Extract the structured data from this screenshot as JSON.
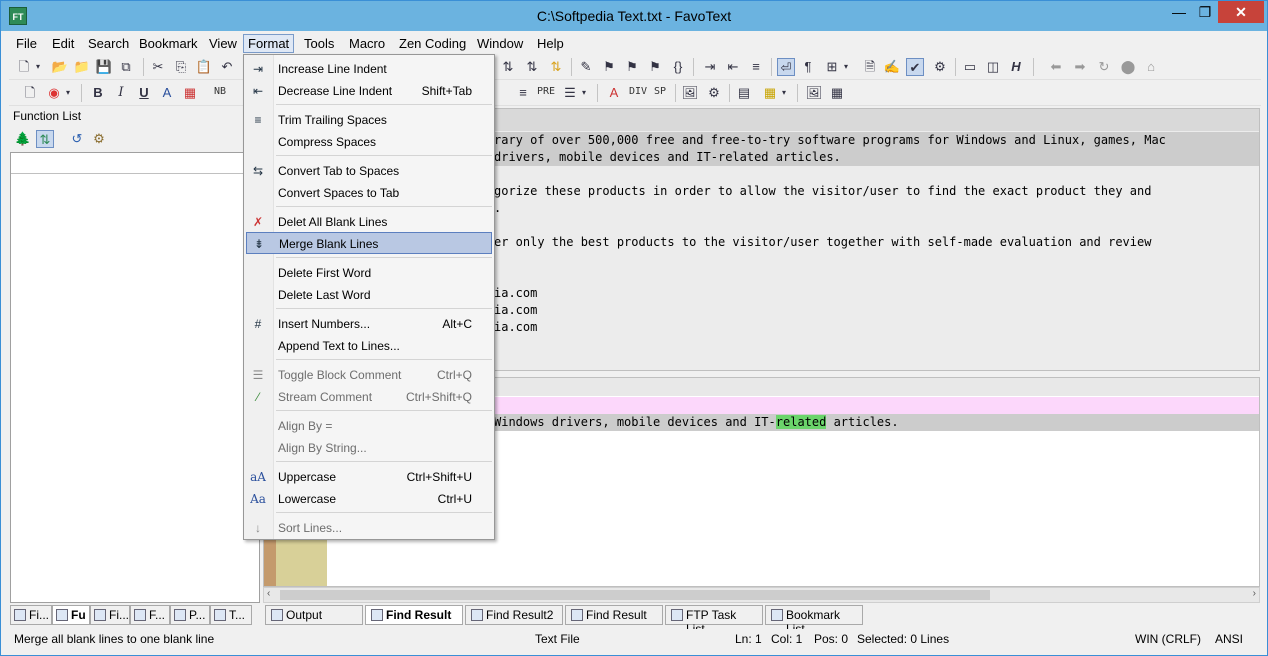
{
  "window": {
    "title": "C:\\Softpedia Text.txt - FavoText",
    "app_icon_text": "FT",
    "minimize": "—",
    "maximize": "❐",
    "close": "✕"
  },
  "menu": [
    "File",
    "Edit",
    "Search",
    "Bookmark",
    "View",
    "Format",
    "Tools",
    "Macro",
    "Zen Coding",
    "Window",
    "Help"
  ],
  "toolbar2_text": {
    "nb": "NB",
    "pre": "PRE",
    "div": "DIV",
    "sp": "SP"
  },
  "function_list": {
    "title": "Function List"
  },
  "editor": {
    "lines": [
      "rary of over 500,000 free and free-to-try software programs for Windows and Linux, games, Mac",
      "drivers, mobile devices and IT-related articles.",
      "",
      "gorize these products in order to allow the visitor/user to find the exact product they and",
      ".",
      "",
      "er only the best products to the visitor/user together with self-made evaluation and review",
      "",
      "",
      "ia.com",
      "ia.com",
      "ia.com"
    ]
  },
  "result_pane": {
    "line_before": "Windows drivers, mobile devices and IT-",
    "match": "related",
    "line_after": " articles."
  },
  "format_menu": {
    "items": [
      {
        "label": "Increase Line Indent",
        "shortcut": "",
        "icon": "increase-indent-icon",
        "glyph": "⇥",
        "disabled": false,
        "selected": false
      },
      {
        "label": "Decrease Line Indent",
        "shortcut": "Shift+Tab",
        "icon": "decrease-indent-icon",
        "glyph": "⇤",
        "disabled": false,
        "selected": false
      },
      {
        "label": "Trim Trailing Spaces",
        "shortcut": "",
        "icon": "trim-spaces-icon",
        "glyph": "≡",
        "disabled": false,
        "selected": false
      },
      {
        "label": "Compress Spaces",
        "shortcut": "",
        "icon": "",
        "glyph": "",
        "disabled": false,
        "selected": false
      },
      {
        "label": "Convert Tab to Spaces",
        "shortcut": "",
        "icon": "tab-to-spaces-icon",
        "glyph": "⇆",
        "disabled": false,
        "selected": false
      },
      {
        "label": "Convert Spaces to Tab",
        "shortcut": "",
        "icon": "",
        "glyph": "",
        "disabled": false,
        "selected": false
      },
      {
        "label": "Delet All Blank Lines",
        "shortcut": "",
        "icon": "delete-blank-lines-icon",
        "glyph": "✗",
        "disabled": false,
        "selected": false
      },
      {
        "label": "Merge Blank Lines",
        "shortcut": "",
        "icon": "merge-blank-lines-icon",
        "glyph": "⇟",
        "disabled": false,
        "selected": true
      },
      {
        "label": "Delete First Word",
        "shortcut": "",
        "icon": "",
        "glyph": "",
        "disabled": false,
        "selected": false
      },
      {
        "label": "Delete Last Word",
        "shortcut": "",
        "icon": "",
        "glyph": "",
        "disabled": false,
        "selected": false
      },
      {
        "label": "Insert Numbers...",
        "shortcut": "Alt+C",
        "icon": "insert-numbers-icon",
        "glyph": "#",
        "disabled": false,
        "selected": false
      },
      {
        "label": "Append Text to Lines...",
        "shortcut": "",
        "icon": "",
        "glyph": "",
        "disabled": false,
        "selected": false
      },
      {
        "label": "Toggle Block Comment",
        "shortcut": "Ctrl+Q",
        "icon": "block-comment-icon",
        "glyph": "☰",
        "disabled": true,
        "selected": false
      },
      {
        "label": "Stream Comment",
        "shortcut": "Ctrl+Shift+Q",
        "icon": "stream-comment-icon",
        "glyph": "⁄",
        "disabled": true,
        "selected": false
      },
      {
        "label": "Align By =",
        "shortcut": "",
        "icon": "",
        "glyph": "",
        "disabled": true,
        "selected": false
      },
      {
        "label": "Align By String...",
        "shortcut": "",
        "icon": "",
        "glyph": "",
        "disabled": true,
        "selected": false
      },
      {
        "label": "Uppercase",
        "shortcut": "Ctrl+Shift+U",
        "icon": "uppercase-icon",
        "glyph": "aA",
        "disabled": false,
        "selected": false
      },
      {
        "label": "Lowercase",
        "shortcut": "Ctrl+U",
        "icon": "lowercase-icon",
        "glyph": "Aa",
        "disabled": false,
        "selected": false
      },
      {
        "label": "Sort Lines...",
        "shortcut": "",
        "icon": "sort-lines-icon",
        "glyph": "↓",
        "disabled": true,
        "selected": false
      }
    ]
  },
  "left_tabs": [
    "Fi...",
    "Fu",
    "Fi...",
    "F...",
    "P...",
    "T..."
  ],
  "bottom_tabs": [
    "Output",
    "Find Result",
    "Find Result2",
    "Find Result",
    "FTP Task List",
    "Bookmark List"
  ],
  "status": {
    "message": "Merge all blank lines to one blank line",
    "file_type": "Text File",
    "ln": "Ln: 1",
    "col": "Col: 1",
    "pos": "Pos: 0",
    "selected": "Selected: 0 Lines",
    "eol": "WIN (CRLF)",
    "encoding": "ANSI"
  }
}
